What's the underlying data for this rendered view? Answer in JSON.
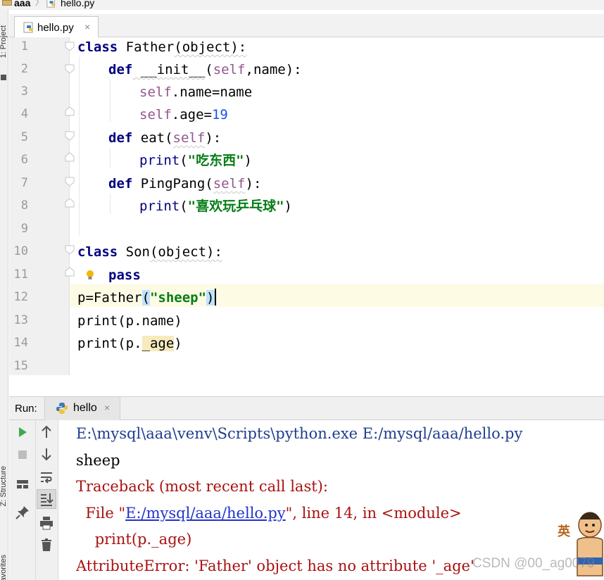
{
  "breadcrumb": {
    "project": "aaa",
    "file": "hello.py"
  },
  "left_strip": {
    "project_label": "1: Project",
    "structure_label": "Z: Structure",
    "favorites_label": "Favorites"
  },
  "editor": {
    "tab_label": "hello.py",
    "tab_close": "×",
    "line_numbers": [
      "1",
      "2",
      "3",
      "4",
      "5",
      "6",
      "7",
      "8",
      "9",
      "10",
      "11",
      "12",
      "13",
      "14",
      "15"
    ],
    "code": {
      "l1": {
        "kw": "class",
        "name": " Father",
        "args": "(object):"
      },
      "l2": {
        "kw": "def",
        "name": " __init__",
        "open": "(",
        "self": "self",
        "rest": ",name):"
      },
      "l3": {
        "self": "self",
        "rest": ".name=name"
      },
      "l4": {
        "self": "self",
        "rest": ".age=",
        "num": "19"
      },
      "l5": {
        "kw": "def",
        "name": " eat",
        "open": "(",
        "self": "self",
        "close": "):"
      },
      "l6": {
        "fn": "print",
        "open": "(",
        "str": "\"吃东西\"",
        "close": ")"
      },
      "l7": {
        "kw": "def",
        "name": " PingPang",
        "open": "(",
        "self": "self",
        "close": "):"
      },
      "l8": {
        "fn": "print",
        "open": "(",
        "str": "\"喜欢玩乒乓球\"",
        "close": ")"
      },
      "l10": {
        "kw": "class",
        "name": " Son",
        "args": "(object):"
      },
      "l11": {
        "kw": "pass"
      },
      "l12": {
        "pre": "p=Father",
        "open": "(",
        "str": "\"sheep\"",
        "close": ")"
      },
      "l13": {
        "text": "print(p.name)"
      },
      "l14": {
        "pre": "print(p.",
        "attr": "_age",
        "close": ")"
      }
    }
  },
  "run": {
    "title": "Run:",
    "tab_label": "hello",
    "tab_close": "×",
    "console": {
      "line1": "E:\\mysql\\aaa\\venv\\Scripts\\python.exe E:/mysql/aaa/hello.py",
      "line2": "sheep",
      "line3": "Traceback (most recent call last):",
      "line4_pre": "  File \"",
      "line4_link": "E:/mysql/aaa/hello.py",
      "line4_post": "\", line 14, in <module>",
      "line5": "    print(p._age)",
      "line6": "AttributeError: 'Father' object has no attribute '_age'"
    }
  },
  "overlays": {
    "watermark": "CSDN @00_ag0079",
    "ime_badge": "英"
  },
  "colors": {
    "keyword": "#000080",
    "self": "#94558d",
    "number": "#1750eb",
    "string": "#067d17",
    "error": "#a8110f",
    "console_path": "#1f3d8f"
  },
  "icons": [
    "python-file-icon",
    "folder-icon",
    "run-icon",
    "stop-icon",
    "layout-icon",
    "pin-icon",
    "up-arrow-icon",
    "down-arrow-icon",
    "soft-wrap-icon",
    "scroll-to-end-icon",
    "print-icon",
    "trash-icon",
    "lightbulb-icon",
    "fold-marker-icon"
  ]
}
